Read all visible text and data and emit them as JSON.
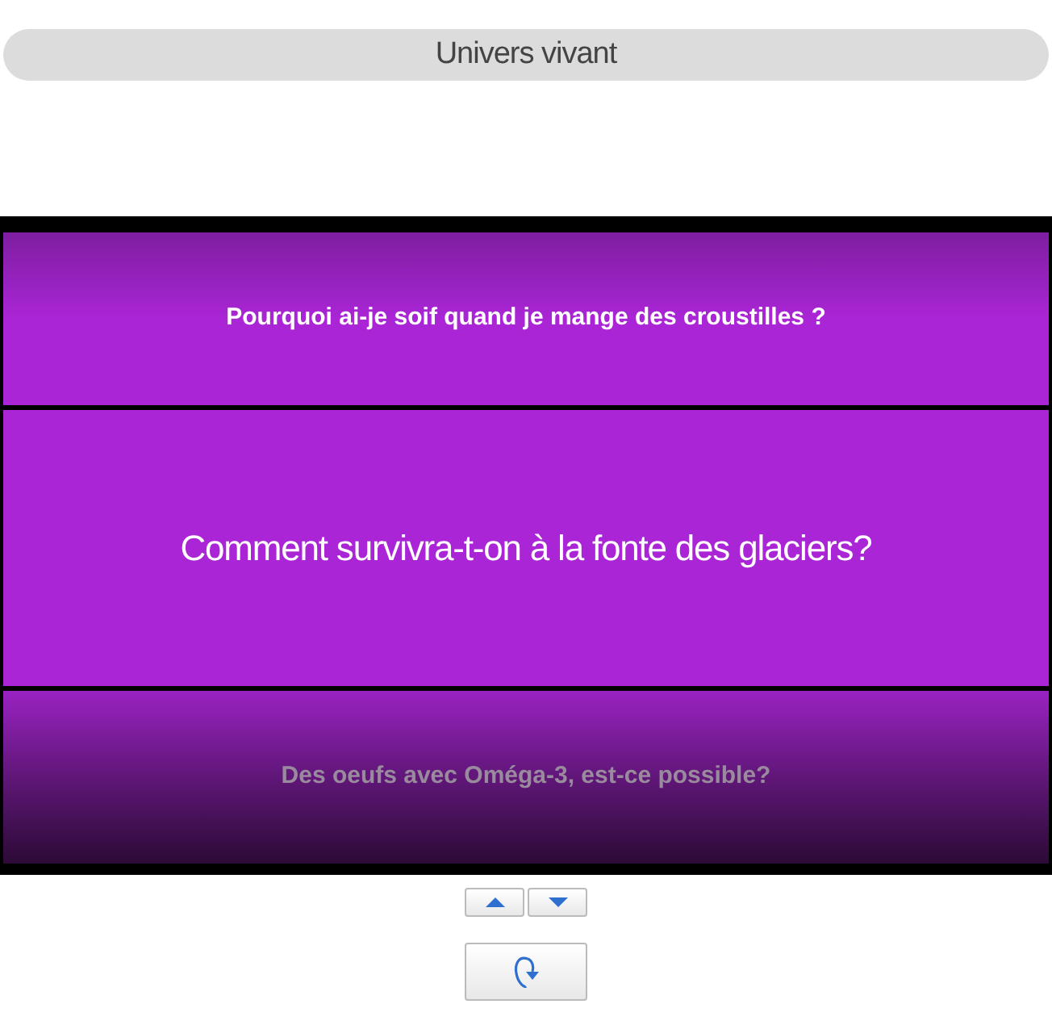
{
  "header": {
    "title": "Univers vivant"
  },
  "questions": [
    {
      "text": "Pourquoi ai-je soif quand je mange des croustilles ?",
      "selected": false,
      "kind": "previous"
    },
    {
      "text": "Comment survivra-t-on à la fonte des glaciers?",
      "selected": true,
      "kind": "current"
    },
    {
      "text": "Des oeufs avec Oméga-3, est-ce possible?",
      "selected": false,
      "kind": "next"
    }
  ]
}
